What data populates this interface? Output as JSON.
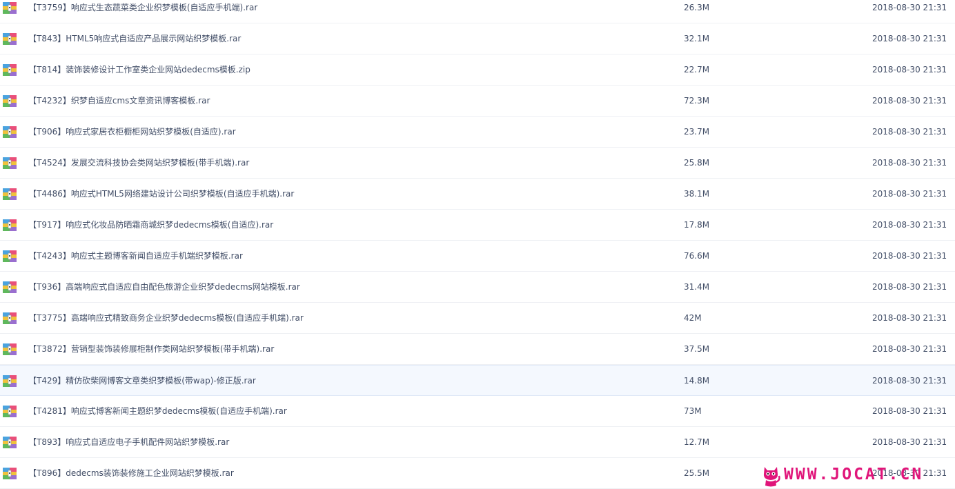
{
  "files": [
    {
      "name": "【T3759】响应式生态蔬菜类企业织梦模板(自适应手机端).rar",
      "size": "26.3M",
      "date": "2018-08-30 21:31",
      "icon": "archive-icon"
    },
    {
      "name": "【T843】HTML5响应式自适应产品展示网站织梦模板.rar",
      "size": "32.1M",
      "date": "2018-08-30 21:31",
      "icon": "archive-icon"
    },
    {
      "name": "【T814】装饰装修设计工作室类企业网站dedecms模板.zip",
      "size": "22.7M",
      "date": "2018-08-30 21:31",
      "icon": "archive-icon"
    },
    {
      "name": "【T4232】织梦自适应cms文章资讯博客模板.rar",
      "size": "72.3M",
      "date": "2018-08-30 21:31",
      "icon": "archive-icon"
    },
    {
      "name": "【T906】响应式家居衣柜橱柜网站织梦模板(自适应).rar",
      "size": "23.7M",
      "date": "2018-08-30 21:31",
      "icon": "archive-icon"
    },
    {
      "name": "【T4524】发展交流科技协会类网站织梦模板(带手机端).rar",
      "size": "25.8M",
      "date": "2018-08-30 21:31",
      "icon": "archive-icon"
    },
    {
      "name": "【T4486】响应式HTML5网络建站设计公司织梦模板(自适应手机端).rar",
      "size": "38.1M",
      "date": "2018-08-30 21:31",
      "icon": "archive-icon"
    },
    {
      "name": "【T917】响应式化妆品防晒霜商城织梦dedecms模板(自适应).rar",
      "size": "17.8M",
      "date": "2018-08-30 21:31",
      "icon": "archive-icon"
    },
    {
      "name": "【T4243】响应式主题博客新闻自适应手机端织梦模板.rar",
      "size": "76.6M",
      "date": "2018-08-30 21:31",
      "icon": "archive-icon"
    },
    {
      "name": "【T936】高端响应式自适应自由配色旅游企业织梦dedecms网站模板.rar",
      "size": "31.4M",
      "date": "2018-08-30 21:31",
      "icon": "archive-icon"
    },
    {
      "name": "【T3775】高端响应式精致商务企业织梦dedecms模板(自适应手机端).rar",
      "size": "42M",
      "date": "2018-08-30 21:31",
      "icon": "archive-icon"
    },
    {
      "name": "【T3872】营销型装饰装修展柜制作类网站织梦模板(带手机端).rar",
      "size": "37.5M",
      "date": "2018-08-30 21:31",
      "icon": "archive-icon"
    },
    {
      "name": "【T429】精仿砍柴网博客文章类织梦模板(带wap)-修正版.rar",
      "size": "14.8M",
      "date": "2018-08-30 21:31",
      "icon": "archive-icon",
      "highlighted": true
    },
    {
      "name": "【T4281】响应式博客新闻主题织梦dedecms模板(自适应手机端).rar",
      "size": "73M",
      "date": "2018-08-30 21:31",
      "icon": "archive-icon"
    },
    {
      "name": "【T893】响应式自适应电子手机配件网站织梦模板.rar",
      "size": "12.7M",
      "date": "2018-08-30 21:31",
      "icon": "archive-icon"
    },
    {
      "name": "【T896】dedecms装饰装修施工企业网站织梦模板.rar",
      "size": "25.5M",
      "date": "2018-08-30 21:31",
      "icon": "archive-icon"
    }
  ],
  "watermark": {
    "text": "WWW.JOCAT.CN",
    "icon": "cat-mascot-icon",
    "color": "#e0157a"
  },
  "colors": {
    "row_border": "#eef0f4",
    "highlight_bg": "#f4f8fe",
    "text": "#424e67"
  }
}
